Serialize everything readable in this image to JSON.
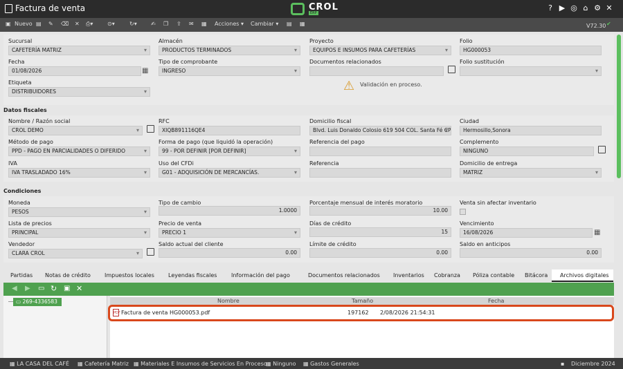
{
  "window": {
    "title": "Factura de venta",
    "logo": "CROL",
    "logo_sub": "ERP",
    "icons": [
      "help-icon",
      "youtube-icon",
      "chat-icon",
      "home-icon",
      "settings-icon",
      "close-icon"
    ]
  },
  "toolbar": {
    "new_label": "Nuevo",
    "actions_label": "Acciones",
    "change_label": "Cambiar",
    "version": "V72.30"
  },
  "header": {
    "sucursal": {
      "label": "Sucursal",
      "value": "CAFETERÍA MATRIZ"
    },
    "almacen": {
      "label": "Almacén",
      "value": "PRODUCTOS TERMINADOS"
    },
    "proyecto": {
      "label": "Proyecto",
      "value": "EQUIPOS E INSUMOS PARA CAFETERÍAS"
    },
    "folio": {
      "label": "Folio",
      "value": "HG000053"
    },
    "fecha": {
      "label": "Fecha",
      "value": "01/08/2026"
    },
    "tipo_comprobante": {
      "label": "Tipo de comprobante",
      "value": "INGRESO"
    },
    "documentos_relacionados": {
      "label": "Documentos relacionados",
      "value": ""
    },
    "folio_sustitucion": {
      "label": "Folio sustitución",
      "value": ""
    },
    "etiqueta": {
      "label": "Etiqueta",
      "value": "DISTRIBUIDORES"
    },
    "validation": "Validación en proceso."
  },
  "fiscal": {
    "section": "Datos fiscales",
    "nombre": {
      "label": "Nombre / Razón social",
      "value": "CROL DEMO"
    },
    "rfc": {
      "label": "RFC",
      "value": "XIQB891116QE4"
    },
    "domicilio": {
      "label": "Domicilio fiscal",
      "value": "Blvd. Luis Donaldo Colosio 619 504 COL. Santa Fé CP.I"
    },
    "ciudad": {
      "label": "Ciudad",
      "value": "Hermosillo,Sonora"
    },
    "metodo_pago": {
      "label": "Método de pago",
      "value": "PPD - PAGO EN PARCIALIDADES O DIFERIDO"
    },
    "forma_pago": {
      "label": "Forma de pago (que liquidó la operación)",
      "value": "99 - POR DEFINIR [POR DEFINIR]"
    },
    "ref_pago": {
      "label": "Referencia del pago",
      "value": ""
    },
    "complemento": {
      "label": "Complemento",
      "value": "NINGUNO"
    },
    "iva": {
      "label": "IVA",
      "value": "IVA TRASLADADO 16%"
    },
    "uso_cfdi": {
      "label": "Uso del CFDi",
      "value": "G01 - ADQUISICIÓN DE MERCANCÍAS."
    },
    "referencia": {
      "label": "Referencia",
      "value": ""
    },
    "domicilio_entrega": {
      "label": "Domicilio de entrega",
      "value": "MATRIZ"
    }
  },
  "conditions": {
    "section": "Condiciones",
    "moneda": {
      "label": "Moneda",
      "value": "PESOS"
    },
    "tipo_cambio": {
      "label": "Tipo de cambio",
      "value": "1.0000"
    },
    "interes": {
      "label": "Porcentaje mensual de interés moratorio",
      "value": "10.00"
    },
    "sin_inventario": {
      "label": "Venta sin afectar inventario"
    },
    "lista_precios": {
      "label": "Lista de precios",
      "value": "PRINCIPAL"
    },
    "precio_venta": {
      "label": "Precio de venta",
      "value": "PRECIO 1"
    },
    "dias_credito": {
      "label": "Días de crédito",
      "value": "15"
    },
    "vencimiento": {
      "label": "Vencimiento",
      "value": "16/08/2026"
    },
    "vendedor": {
      "label": "Vendedor",
      "value": "CLARA CROL"
    },
    "saldo_cliente": {
      "label": "Saldo actual del cliente",
      "value": "0.00"
    },
    "limite_credito": {
      "label": "Límite de crédito",
      "value": "0.00"
    },
    "saldo_anticipos": {
      "label": "Saldo en anticipos",
      "value": "0.00"
    }
  },
  "tabs": [
    "Partidas",
    "Notas de crédito",
    "Impuestos locales",
    "Leyendas fiscales",
    "Información del pago",
    "Documentos relacionados",
    "Inventarios",
    "Cobranza",
    "Póliza contable",
    "Bitácora",
    "Archivos digitales"
  ],
  "files": {
    "folder": "269-4336583",
    "columns": [
      "Nombre",
      "Tamaño",
      "Fecha"
    ],
    "rows": [
      {
        "name": "Factura de venta HG000053.pdf",
        "size": "197162",
        "date": "2/08/2026 21:54:31"
      }
    ]
  },
  "statusbar": {
    "company": "LA CASA DEL CAFÉ",
    "branch": "Cafetería Matriz",
    "project": "Materiales E Insumos de Servicios En Proceso",
    "doc": "Ninguno",
    "expenses": "Gastos Generales",
    "period": "Diciembre 2024"
  },
  "colors": {
    "accent": "#5bbf5e",
    "highlight": "#d9481c"
  }
}
